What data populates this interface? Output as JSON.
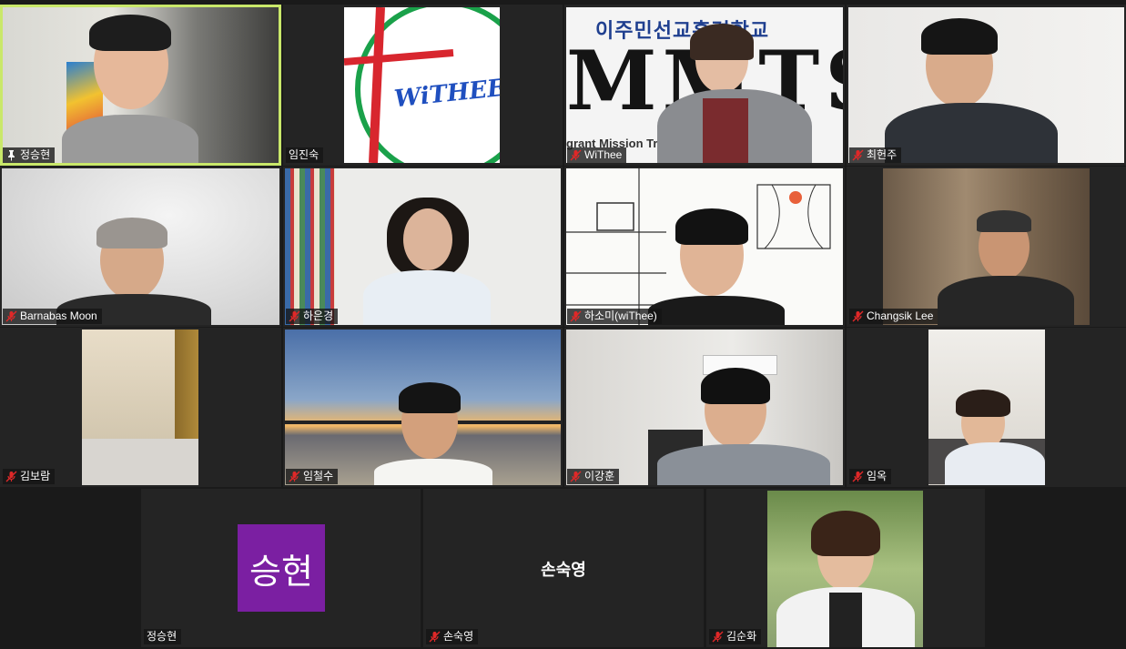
{
  "participants": [
    {
      "name": "정승현",
      "icon": "pin-icon"
    },
    {
      "name": "임진숙",
      "icon": "none"
    },
    {
      "name": "WiThee",
      "icon": "mic-muted-icon"
    },
    {
      "name": "최헌주",
      "icon": "mic-muted-icon"
    },
    {
      "name": "Barnabas Moon",
      "icon": "mic-muted-icon"
    },
    {
      "name": "하은경",
      "icon": "mic-muted-icon"
    },
    {
      "name": "하소미(wiThee)",
      "icon": "mic-muted-icon"
    },
    {
      "name": "Changsik Lee",
      "icon": "mic-muted-icon"
    },
    {
      "name": "김보람",
      "icon": "mic-muted-icon"
    },
    {
      "name": "임철수",
      "icon": "mic-muted-icon"
    },
    {
      "name": "이강훈",
      "icon": "mic-muted-icon"
    },
    {
      "name": "임옥",
      "icon": "mic-muted-icon"
    },
    {
      "name": "정승현",
      "icon": "none",
      "avatar_text": "승현"
    },
    {
      "name": "손숙영",
      "icon": "mic-muted-icon",
      "center_text": "손숙영"
    },
    {
      "name": "김순화",
      "icon": "mic-muted-icon"
    }
  ],
  "logos": {
    "withee_text": "WiTHEE",
    "school_title": "이주민선교훈련학교",
    "school_big": "MMTS",
    "school_subtitle": "grant Mission Tra"
  },
  "colors": {
    "speaking_border": "#c9e86a",
    "avatar_bg": "#7b1fa2",
    "muted_red": "#e02828"
  }
}
